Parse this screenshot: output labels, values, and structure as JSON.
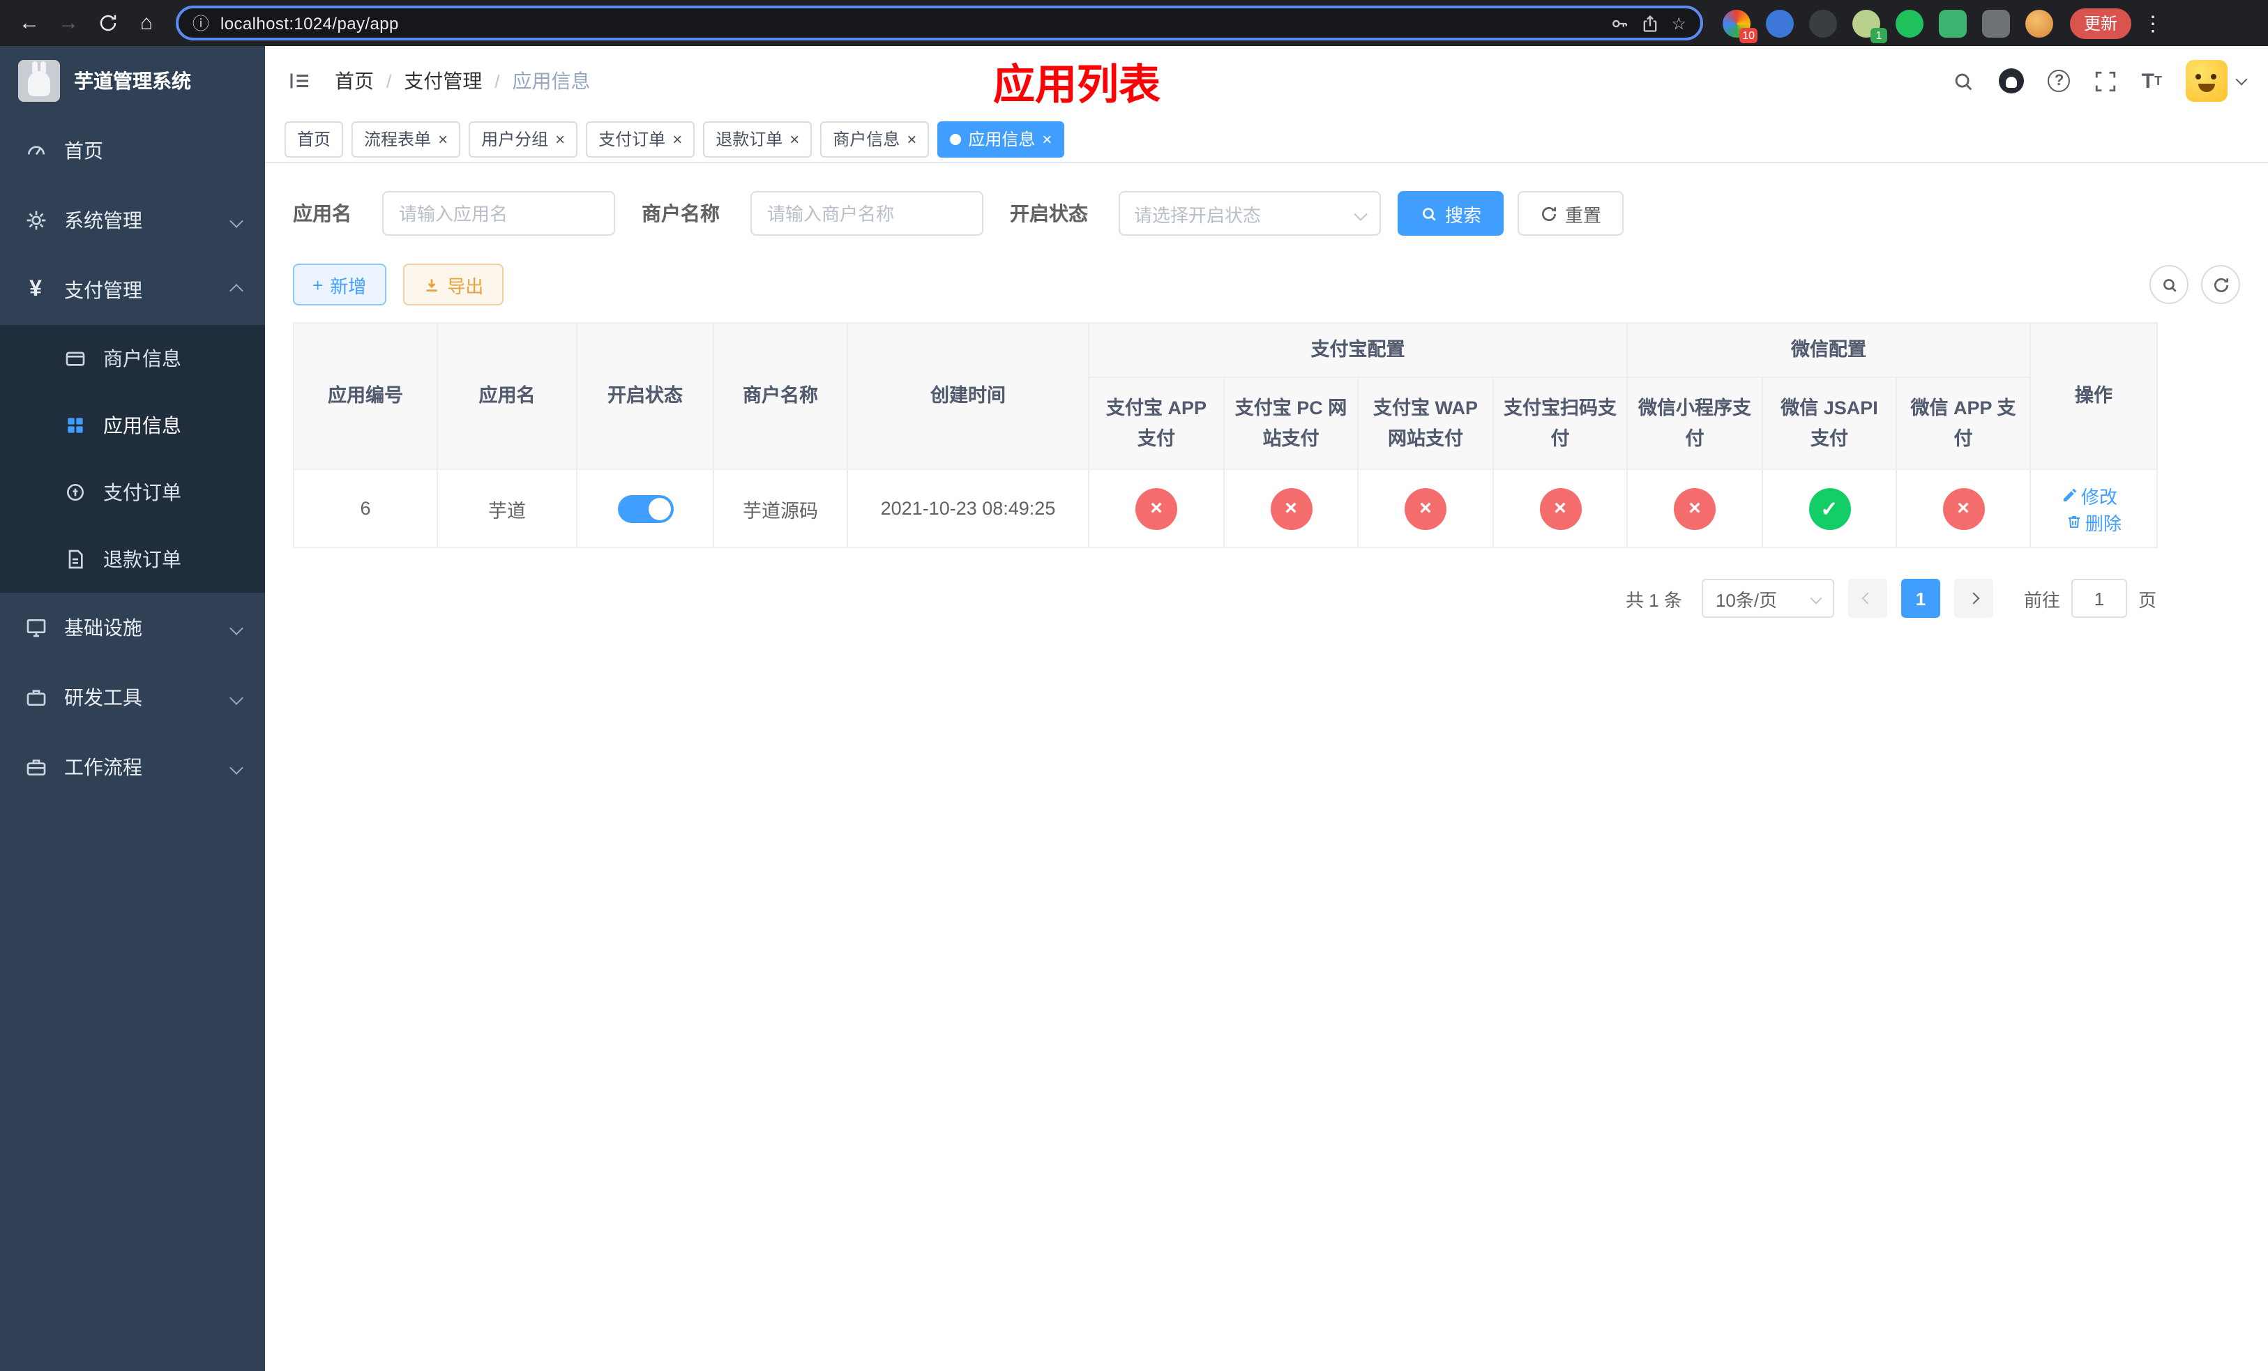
{
  "colors": {
    "primary": "#409eff",
    "danger": "#f56c6c",
    "success": "#13ce66",
    "warning": "#e6a23c",
    "title_red": "#fb0205",
    "sidebar_bg": "#304156",
    "sidebar_sub_bg": "#1f2d3d",
    "chrome_bg": "#202124",
    "url_focus_border": "#5a8bef"
  },
  "icons": {
    "back": "←",
    "forward": "→",
    "home": "⌂",
    "info": "ⓘ",
    "star": "☆",
    "dots": "⋮",
    "close": "×",
    "check": "✓",
    "cross": "×",
    "plus": "+",
    "question": "?",
    "font_size_big": "T",
    "font_size_small": "T",
    "yen": "¥"
  },
  "browser": {
    "url": "localhost:1024/pay/app",
    "update_label": "更新",
    "ext_badge_10": "10",
    "ext_badge_1": "1"
  },
  "sidebar": {
    "logo_title": "芋道管理系统",
    "items": [
      {
        "label": "首页"
      },
      {
        "label": "系统管理"
      },
      {
        "label": "支付管理"
      },
      {
        "label": "基础设施"
      },
      {
        "label": "研发工具"
      },
      {
        "label": "工作流程"
      }
    ],
    "pay_children": [
      {
        "label": "商户信息"
      },
      {
        "label": "应用信息"
      },
      {
        "label": "支付订单"
      },
      {
        "label": "退款订单"
      }
    ]
  },
  "header": {
    "breadcrumb": [
      "首页",
      "支付管理",
      "应用信息"
    ],
    "breadcrumb_sep": "/",
    "page_title": "应用列表"
  },
  "tabs": [
    {
      "label": "首页"
    },
    {
      "label": "流程表单"
    },
    {
      "label": "用户分组"
    },
    {
      "label": "支付订单"
    },
    {
      "label": "退款订单"
    },
    {
      "label": "商户信息"
    },
    {
      "label": "应用信息"
    }
  ],
  "filters": {
    "app_name_label": "应用名",
    "app_name_placeholder": "请输入应用名",
    "merchant_label": "商户名称",
    "merchant_placeholder": "请输入商户名称",
    "status_label": "开启状态",
    "status_placeholder": "请选择开启状态",
    "search_label": "搜索",
    "reset_label": "重置"
  },
  "toolbar": {
    "add_label": "新增",
    "export_label": "导出"
  },
  "table": {
    "headers": {
      "app_id": "应用编号",
      "app_name": "应用名",
      "status": "开启状态",
      "merchant": "商户名称",
      "create_time": "创建时间",
      "alipay_group": "支付宝配置",
      "wechat_group": "微信配置",
      "alipay_app": "支付宝 APP 支付",
      "alipay_pc": "支付宝 PC 网站支付",
      "alipay_wap": "支付宝 WAP 网站支付",
      "alipay_qr": "支付宝扫码支付",
      "wx_mini": "微信小程序支付",
      "wx_jsapi": "微信 JSAPI 支付",
      "wx_app": "微信 APP 支付",
      "actions": "操作"
    },
    "rows": [
      {
        "app_id": "6",
        "app_name": "芋道",
        "status_on": true,
        "merchant": "芋道源码",
        "create_time": "2021-10-23 08:49:25",
        "alipay_app": false,
        "alipay_pc": false,
        "alipay_wap": false,
        "alipay_qr": false,
        "wx_mini": false,
        "wx_jsapi": true,
        "wx_app": false,
        "edit_label": "修改",
        "delete_label": "删除"
      }
    ]
  },
  "pagination": {
    "total_text": "共 1 条",
    "page_size": "10条/页",
    "current_page": "1",
    "goto_prefix": "前往",
    "goto_value": "1",
    "goto_suffix": "页"
  }
}
